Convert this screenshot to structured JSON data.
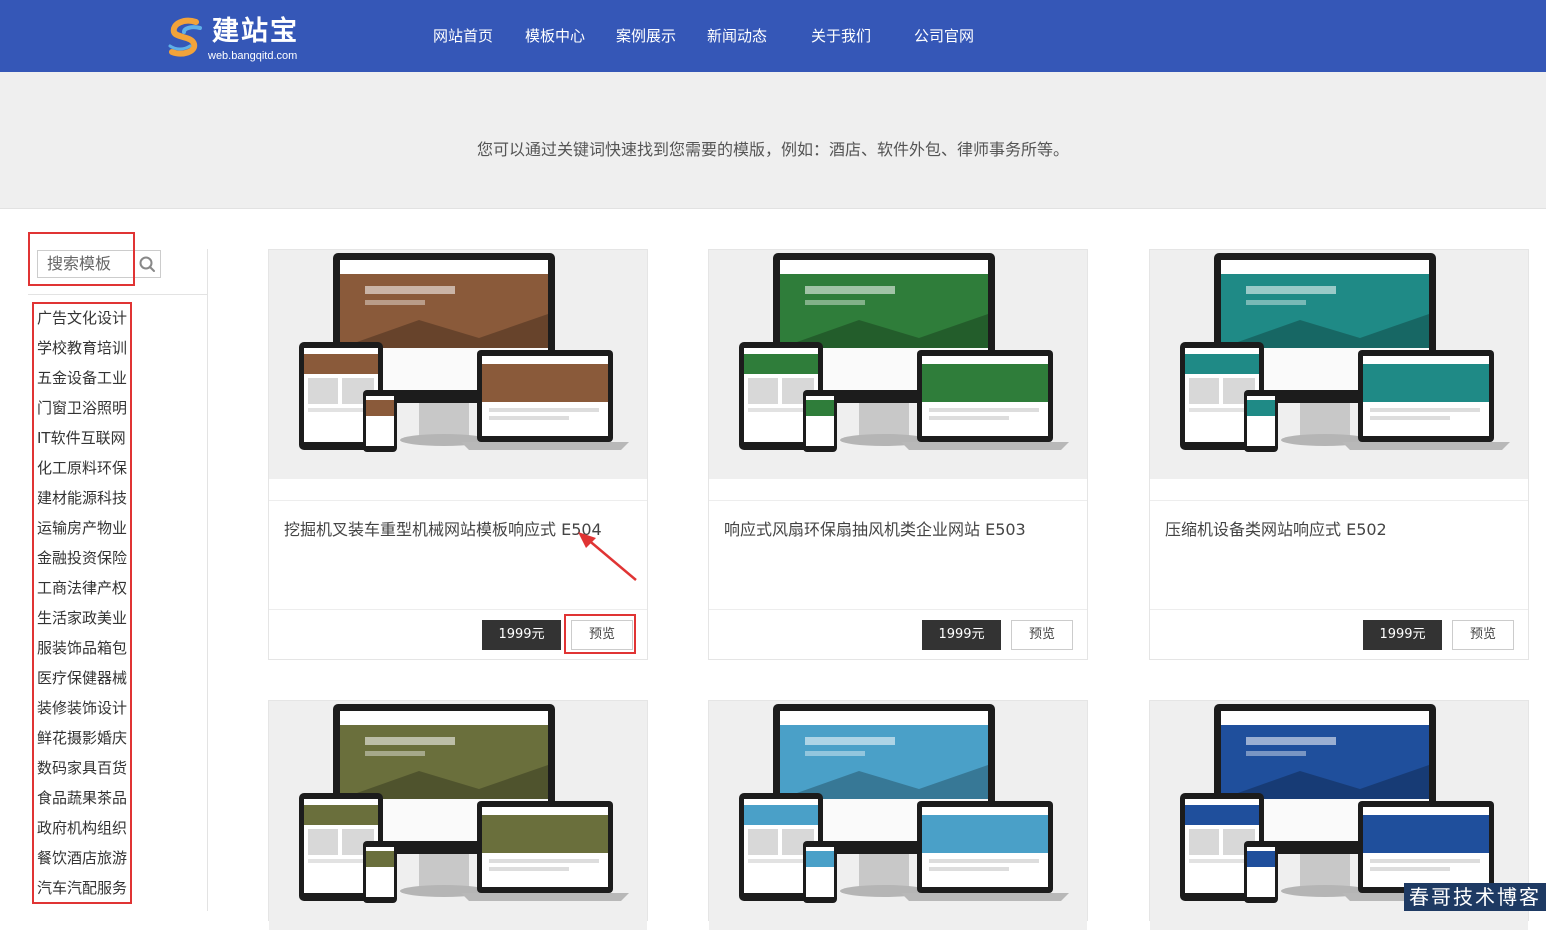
{
  "header": {
    "logo_title": "建站宝",
    "logo_sub": "web.bangqitd.com",
    "nav": [
      {
        "label": "网站首页"
      },
      {
        "label": "模板中心"
      },
      {
        "label": "案例展示"
      },
      {
        "label": "新闻动态"
      },
      {
        "label": "关于我们"
      },
      {
        "label": "公司官网"
      }
    ]
  },
  "banner": {
    "text": "您可以通过关键词快速找到您需要的模版，例如：酒店、软件外包、律师事务所等。"
  },
  "search": {
    "placeholder": "搜索模板",
    "icon": "search-icon"
  },
  "categories": [
    "广告文化设计",
    "学校教育培训",
    "五金设备工业",
    "门窗卫浴照明",
    "IT软件互联网",
    "化工原料环保",
    "建材能源科技",
    "运输房产物业",
    "金融投资保险",
    "工商法律产权",
    "生活家政美业",
    "服装饰品箱包",
    "医疗保健器械",
    "装修装饰设计",
    "鲜花摄影婚庆",
    "数码家具百货",
    "食品蔬果茶品",
    "政府机构组织",
    "餐饮酒店旅游",
    "汽车汽配服务"
  ],
  "templates": [
    {
      "title": "挖掘机叉装车重型机械网站模板响应式 E504",
      "price": "1999元",
      "preview": "预览",
      "theme": "#8a5a3a"
    },
    {
      "title": "响应式风扇环保扇抽风机类企业网站 E503",
      "price": "1999元",
      "preview": "预览",
      "theme": "#2f7d3a"
    },
    {
      "title": "压缩机设备类网站响应式 E502",
      "price": "1999元",
      "preview": "预览",
      "theme": "#1f8a86"
    },
    {
      "title": "",
      "price": "",
      "preview": "",
      "theme": "#6a6f3c"
    },
    {
      "title": "",
      "price": "",
      "preview": "",
      "theme": "#4aa0c8"
    },
    {
      "title": "",
      "price": "",
      "preview": "",
      "theme": "#1f4f9c"
    }
  ],
  "watermark": "春哥技术博客",
  "colors": {
    "header_bg": "#3557b7",
    "annotation": "#e03434",
    "price_bg": "#333333"
  }
}
